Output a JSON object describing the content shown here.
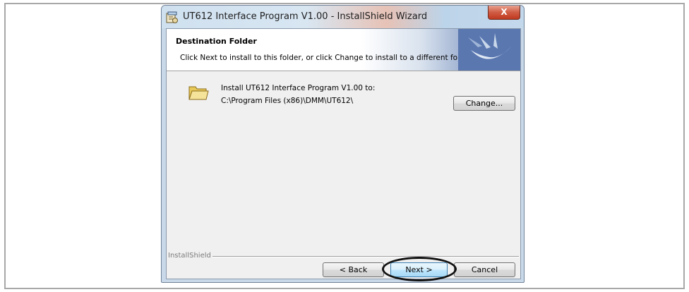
{
  "window": {
    "title": "UT612 Interface Program V1.00 - InstallShield Wizard",
    "close_glyph": "X"
  },
  "banner": {
    "title": "Destination Folder",
    "description": "Click Next to install to this folder, or click Change to install to a different folder."
  },
  "content": {
    "install_text": "Install UT612 Interface Program V1.00 to:",
    "install_path": "C:\\Program Files (x86)\\DMM\\UT612\\"
  },
  "buttons": {
    "change": "Change...",
    "back": "< Back",
    "next": "Next >",
    "cancel": "Cancel"
  },
  "footer": {
    "brand": "InstallShield"
  },
  "icons": {
    "app": "installer-icon",
    "folder": "folder-icon",
    "logo": "installshield-logo-icon"
  },
  "colors": {
    "accent": "#5a77b0",
    "next_highlight": "#bee6fd"
  }
}
